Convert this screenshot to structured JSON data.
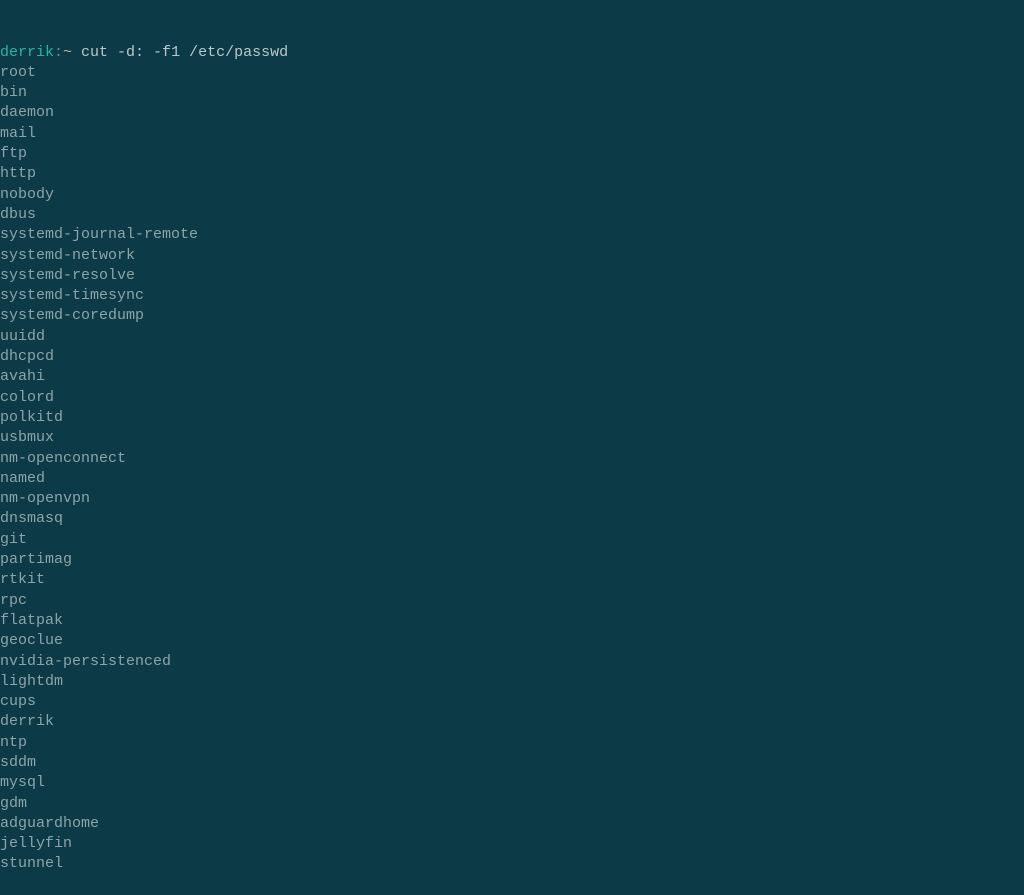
{
  "prompt": {
    "user": "derrik",
    "separator": ":",
    "path": "~",
    "command": " cut -d: -f1 /etc/passwd"
  },
  "output": [
    "root",
    "bin",
    "daemon",
    "mail",
    "ftp",
    "http",
    "nobody",
    "dbus",
    "systemd-journal-remote",
    "systemd-network",
    "systemd-resolve",
    "systemd-timesync",
    "systemd-coredump",
    "uuidd",
    "dhcpcd",
    "avahi",
    "colord",
    "polkitd",
    "usbmux",
    "nm-openconnect",
    "named",
    "nm-openvpn",
    "dnsmasq",
    "git",
    "partimag",
    "rtkit",
    "rpc",
    "flatpak",
    "geoclue",
    "nvidia-persistenced",
    "lightdm",
    "cups",
    "derrik",
    "ntp",
    "sddm",
    "mysql",
    "gdm",
    "adguardhome",
    "jellyfin",
    "stunnel"
  ]
}
